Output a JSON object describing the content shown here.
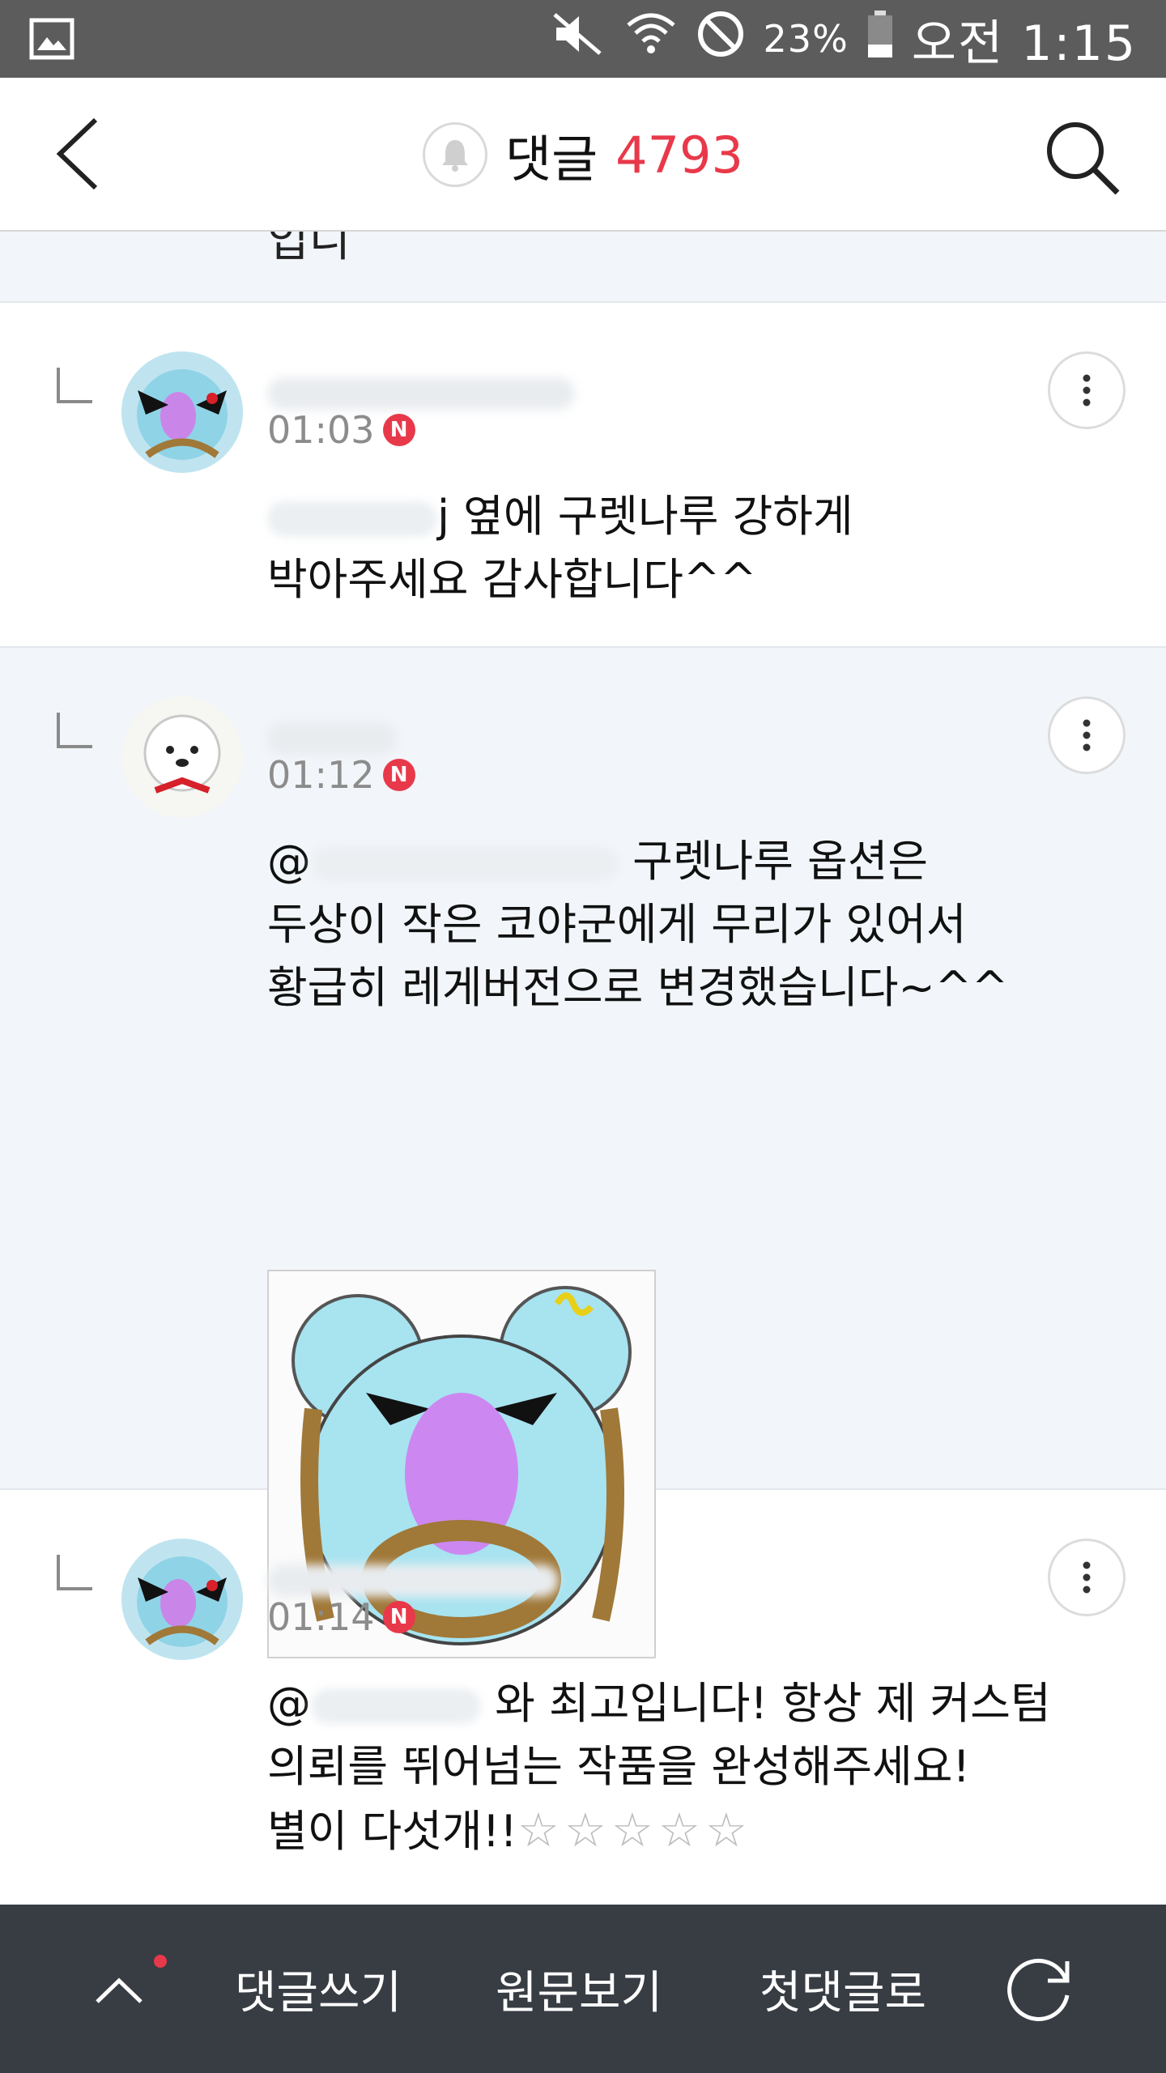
{
  "status_bar": {
    "battery": "23%",
    "time": "오전 1:15",
    "icons": [
      "image-icon",
      "mute-icon",
      "wifi-icon",
      "block-icon",
      "battery-icon"
    ]
  },
  "header": {
    "title": "댓글",
    "count": "4793",
    "count_color": "#e8394a"
  },
  "partial_comment": {
    "text": "입니"
  },
  "comments": [
    {
      "time": "01:03",
      "badge": "N",
      "mention_visible": "j",
      "text_after_mention": " 옆에 구렛나루 강하게",
      "line2": "박아주세요 감사합니다^^"
    },
    {
      "time": "01:12",
      "badge": "N",
      "mention_visible": "@",
      "text_after_mention": " 구렛나루 옵션은",
      "line2": "두상이 작은 코야군에게 무리가 있어서",
      "line3": "황급히 레게버전으로 변경했습니다~^^"
    },
    {
      "time": "01:14",
      "badge": "N",
      "mention_visible": "@",
      "text_after_mention": " 와 최고입니다! 항상 제 커스텀",
      "line2": "의뢰를 뛰어넘는 작품을 완성해주세요!",
      "line3": "별이 다섯개!!",
      "stars": "☆☆☆☆☆"
    }
  ],
  "bottom_bar": {
    "write": "댓글쓰기",
    "original": "원문보기",
    "first": "첫댓글로"
  }
}
